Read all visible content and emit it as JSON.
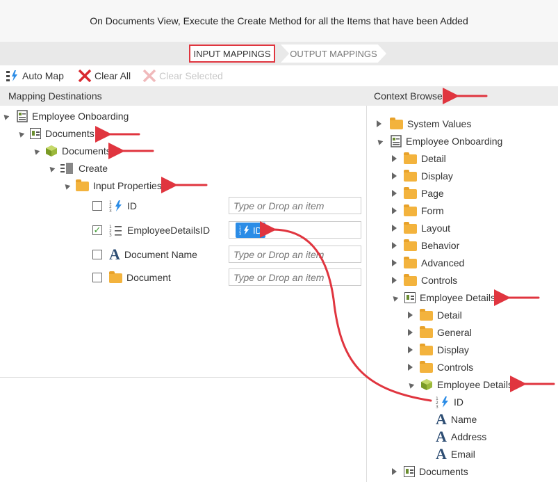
{
  "header": {
    "title": "On Documents View, Execute the Create Method for all the Items that have been Added"
  },
  "steps": {
    "input": "INPUT MAPPINGS",
    "output": "OUTPUT MAPPINGS"
  },
  "toolbar": {
    "auto_map": "Auto Map",
    "clear_all": "Clear All",
    "clear_selected": "Clear Selected"
  },
  "panels": {
    "left_title": "Mapping Destinations",
    "right_title": "Context Browser"
  },
  "left_tree": {
    "root": "Employee Onboarding",
    "documents_view": "Documents",
    "documents_object": "Documents",
    "method": "Create",
    "input_properties": "Input Properties",
    "properties": [
      {
        "label": "ID",
        "checked": false,
        "value": "",
        "placeholder": "Type or Drop an item"
      },
      {
        "label": "EmployeeDetailsID",
        "checked": true,
        "value": "ID",
        "placeholder": "Type or Drop an item"
      },
      {
        "label": "Document Name",
        "checked": false,
        "value": "",
        "placeholder": "Type or Drop an item"
      },
      {
        "label": "Document",
        "checked": false,
        "value": "",
        "placeholder": "Type or Drop an item"
      }
    ]
  },
  "right_tree": {
    "system_values": "System Values",
    "employee_onboarding": "Employee Onboarding",
    "folders": [
      "Detail",
      "Display",
      "Page",
      "Form",
      "Layout",
      "Behavior",
      "Advanced",
      "Controls"
    ],
    "employee_details_view": "Employee Details",
    "sub_folders": [
      "Detail",
      "General",
      "Display",
      "Controls"
    ],
    "employee_details_object": "Employee Details",
    "fields": [
      "ID",
      "Name",
      "Address",
      "Email"
    ],
    "documents": "Documents"
  },
  "colors": {
    "accent_red": "#e0353f",
    "chip_blue": "#2b8ce6",
    "folder": "#f3b33d"
  }
}
